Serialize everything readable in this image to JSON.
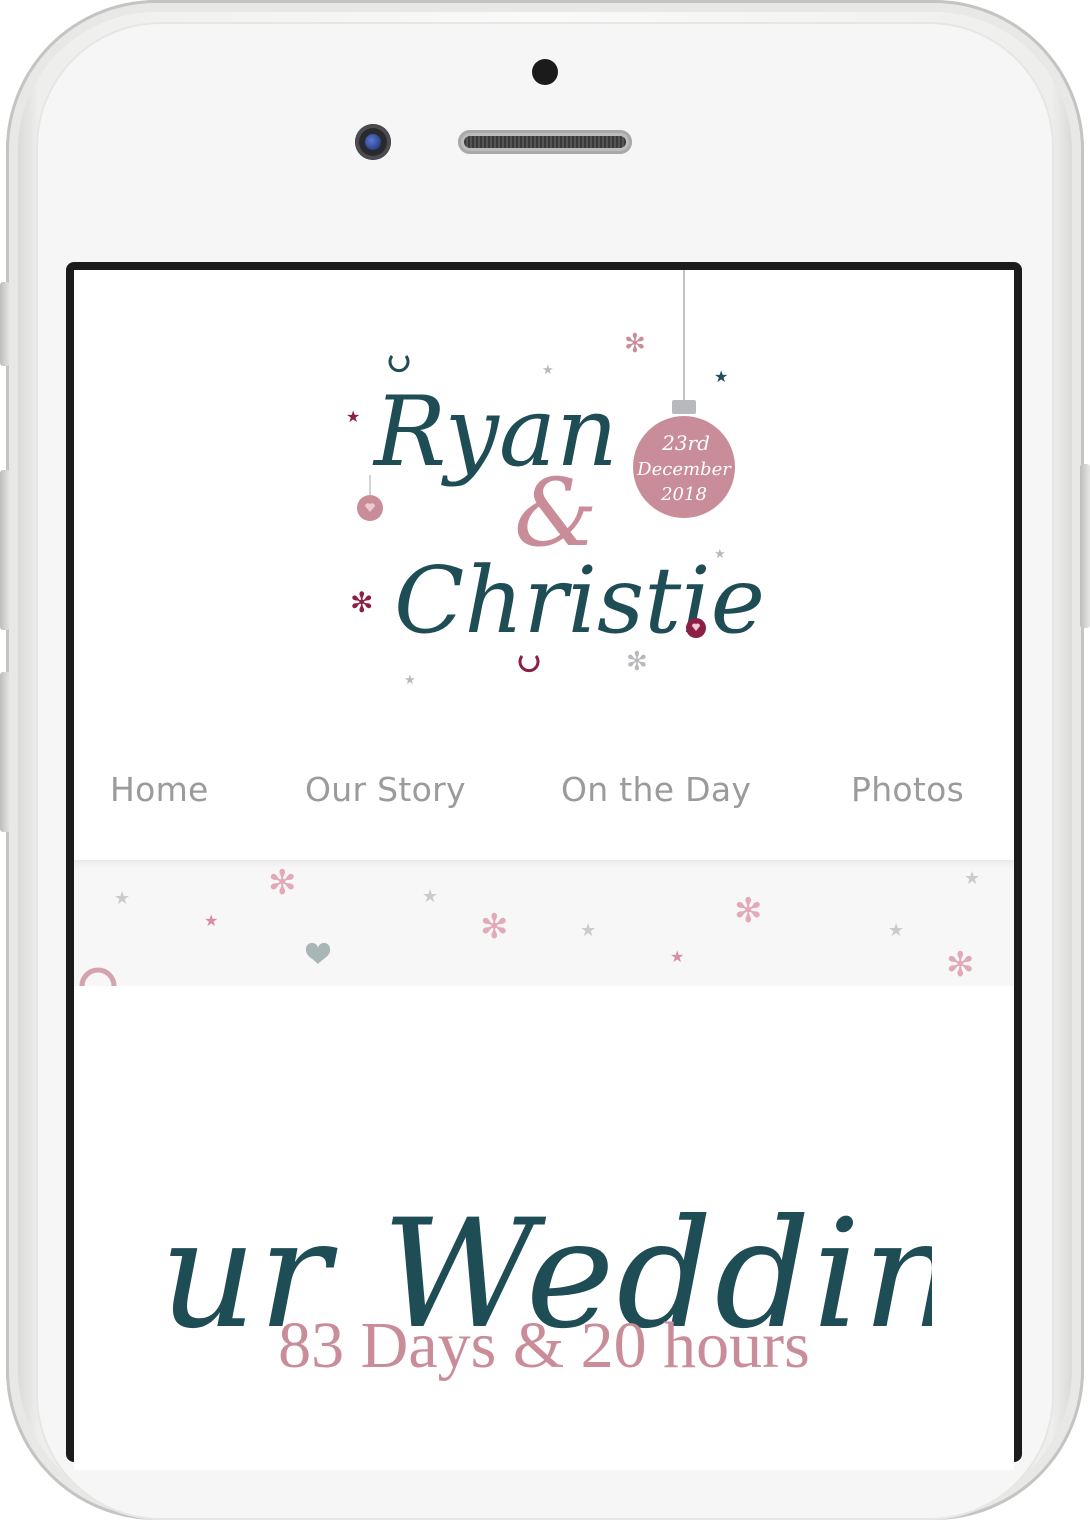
{
  "logo": {
    "name_first": "Ryan",
    "ampersand": "&",
    "name_second": "Christie",
    "date_line1": "23rd",
    "date_line2": "December",
    "date_line3": "2018"
  },
  "nav": {
    "items": [
      {
        "label": "Home"
      },
      {
        "label": "Our Story"
      },
      {
        "label": "On the Day"
      },
      {
        "label": "Photos"
      }
    ]
  },
  "main": {
    "heading": "Our Wedding",
    "countdown": "83 Days & 20 hours"
  },
  "colors": {
    "teal": "#1f4d55",
    "rose": "#c98d99",
    "burgundy": "#8e1f44",
    "nav_text": "#9b9b9b",
    "ornament_grey": "#c2c4c7"
  },
  "icons": [
    "camera-icon",
    "speaker-grille",
    "star-icon",
    "flower-icon",
    "heart-icon",
    "horseshoe-icon",
    "bauble-icon"
  ]
}
